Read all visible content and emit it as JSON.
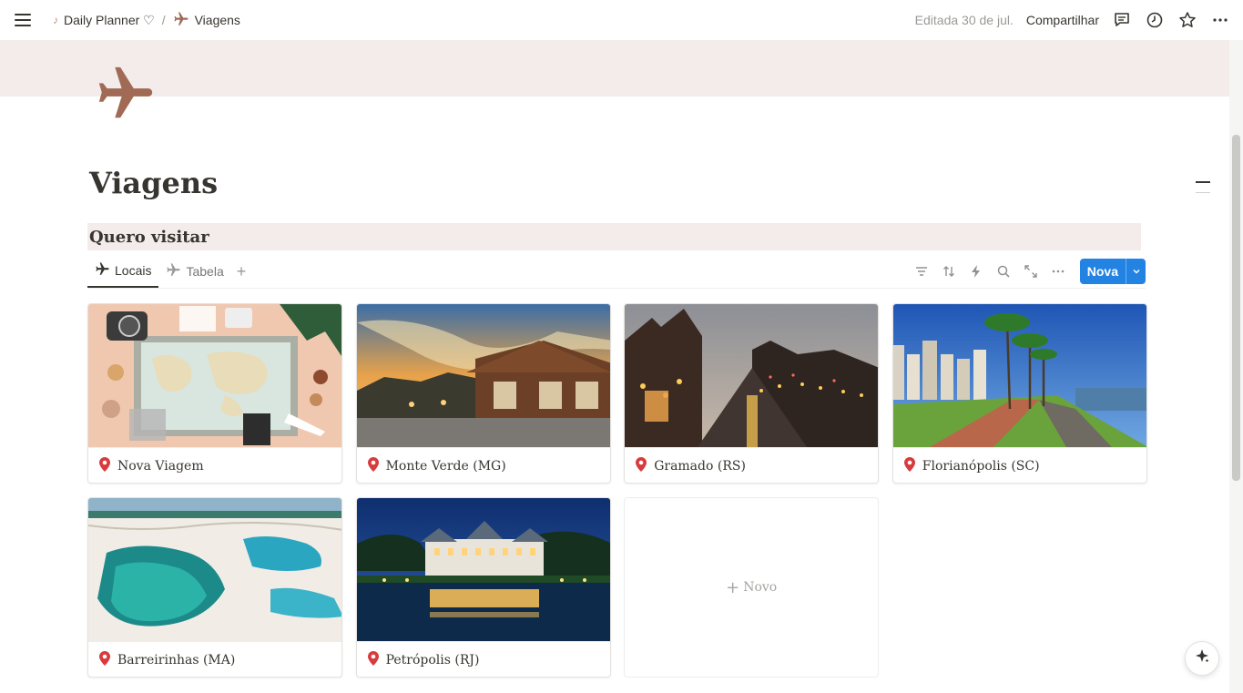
{
  "breadcrumb": {
    "workspace": "Daily Planner ♡",
    "separator": "/",
    "page": "Viagens"
  },
  "topbar": {
    "edited": "Editada 30 de jul.",
    "share": "Compartilhar",
    "icons": [
      "comment-icon",
      "clock-icon",
      "star-icon",
      "more-icon"
    ]
  },
  "page": {
    "title": "Viagens",
    "icon": "airplane-icon",
    "icon_color": "#a06a55",
    "cover_color": "#f3ecea"
  },
  "section": {
    "heading": "Quero visitar"
  },
  "tabs": [
    {
      "label": "Locais",
      "active": true
    },
    {
      "label": "Tabela",
      "active": false
    }
  ],
  "toolbar": {
    "new_label": "Nova",
    "accent": "#2383e2"
  },
  "gallery": {
    "cards": [
      {
        "label": "Nova Viagem"
      },
      {
        "label": "Monte Verde (MG)"
      },
      {
        "label": "Gramado (RS)"
      },
      {
        "label": "Florianópolis (SC)"
      },
      {
        "label": "Barreirinhas (MA)"
      },
      {
        "label": "Petrópolis (RJ)"
      }
    ],
    "new_label": "Novo"
  }
}
